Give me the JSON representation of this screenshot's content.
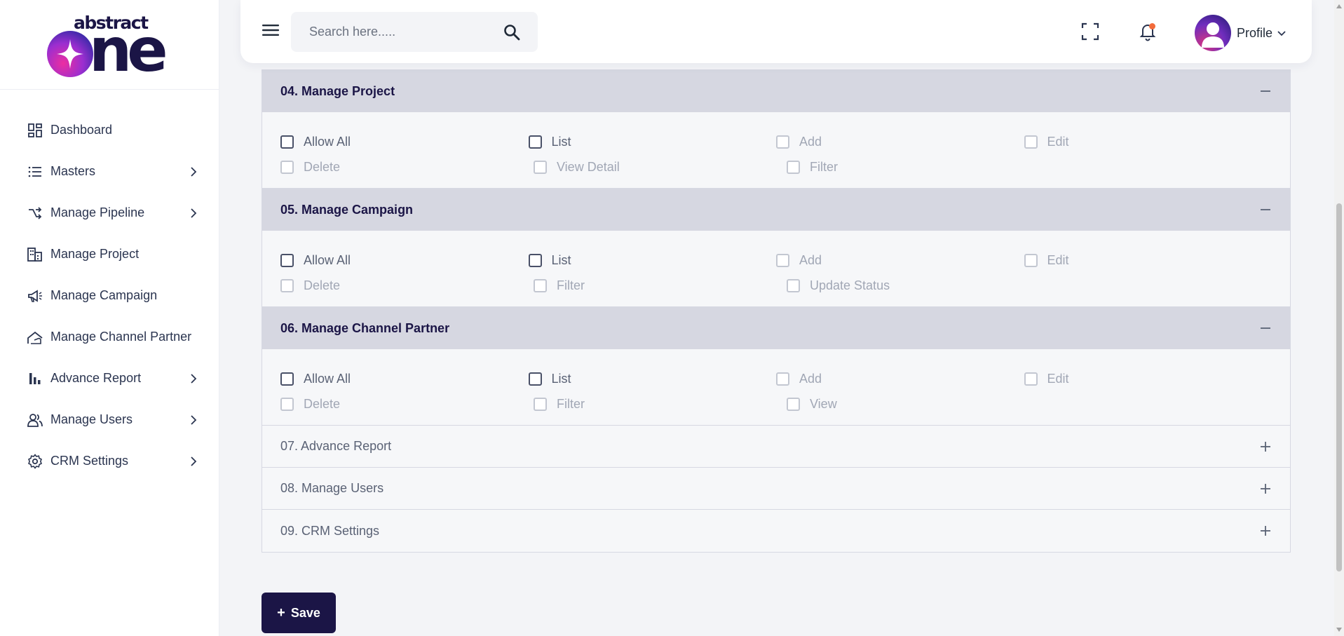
{
  "brand": {
    "top": "abstract",
    "bottom": "ne"
  },
  "sidebar": {
    "items": [
      {
        "label": "Dashboard",
        "icon": "dashboard-icon",
        "has_children": false
      },
      {
        "label": "Masters",
        "icon": "list-icon",
        "has_children": true
      },
      {
        "label": "Manage Pipeline",
        "icon": "pipeline-icon",
        "has_children": true
      },
      {
        "label": "Manage Project",
        "icon": "building-icon",
        "has_children": false
      },
      {
        "label": "Manage Campaign",
        "icon": "megaphone-icon",
        "has_children": false
      },
      {
        "label": "Manage Channel Partner",
        "icon": "handshake-icon",
        "has_children": false
      },
      {
        "label": "Advance Report",
        "icon": "bar-chart-icon",
        "has_children": true
      },
      {
        "label": "Manage Users",
        "icon": "users-icon",
        "has_children": true
      },
      {
        "label": "CRM Settings",
        "icon": "gear-icon",
        "has_children": true
      }
    ]
  },
  "header": {
    "search_placeholder": "Search here.....",
    "profile_label": "Profile"
  },
  "sections": [
    {
      "title": "04. Manage Project",
      "expanded": true,
      "rows": [
        [
          {
            "label": "Allow All",
            "strong": true
          },
          {
            "label": "List",
            "strong": true
          },
          {
            "label": "Add",
            "strong": false
          },
          {
            "label": "Edit",
            "strong": false
          }
        ],
        [
          {
            "label": "Delete",
            "strong": false
          },
          {
            "label": "View Detail",
            "strong": false
          },
          {
            "label": "Filter",
            "strong": false
          }
        ]
      ]
    },
    {
      "title": "05. Manage Campaign",
      "expanded": true,
      "rows": [
        [
          {
            "label": "Allow All",
            "strong": true
          },
          {
            "label": "List",
            "strong": true
          },
          {
            "label": "Add",
            "strong": false
          },
          {
            "label": "Edit",
            "strong": false
          }
        ],
        [
          {
            "label": "Delete",
            "strong": false
          },
          {
            "label": "Filter",
            "strong": false
          },
          {
            "label": "Update Status",
            "strong": false
          }
        ]
      ]
    },
    {
      "title": "06. Manage Channel Partner",
      "expanded": true,
      "rows": [
        [
          {
            "label": "Allow All",
            "strong": true
          },
          {
            "label": "List",
            "strong": true
          },
          {
            "label": "Add",
            "strong": false
          },
          {
            "label": "Edit",
            "strong": false
          }
        ],
        [
          {
            "label": "Delete",
            "strong": false
          },
          {
            "label": "Filter",
            "strong": false
          },
          {
            "label": "View",
            "strong": false
          }
        ]
      ]
    }
  ],
  "collapsed_sections": [
    {
      "title": "07. Advance Report"
    },
    {
      "title": "08. Manage Users"
    },
    {
      "title": "09. CRM Settings"
    }
  ],
  "save_button": {
    "label": "Save"
  },
  "colors": {
    "primary": "#1b1546",
    "section_header": "#d6d7e1",
    "notification_dot": "#f26b3a"
  }
}
